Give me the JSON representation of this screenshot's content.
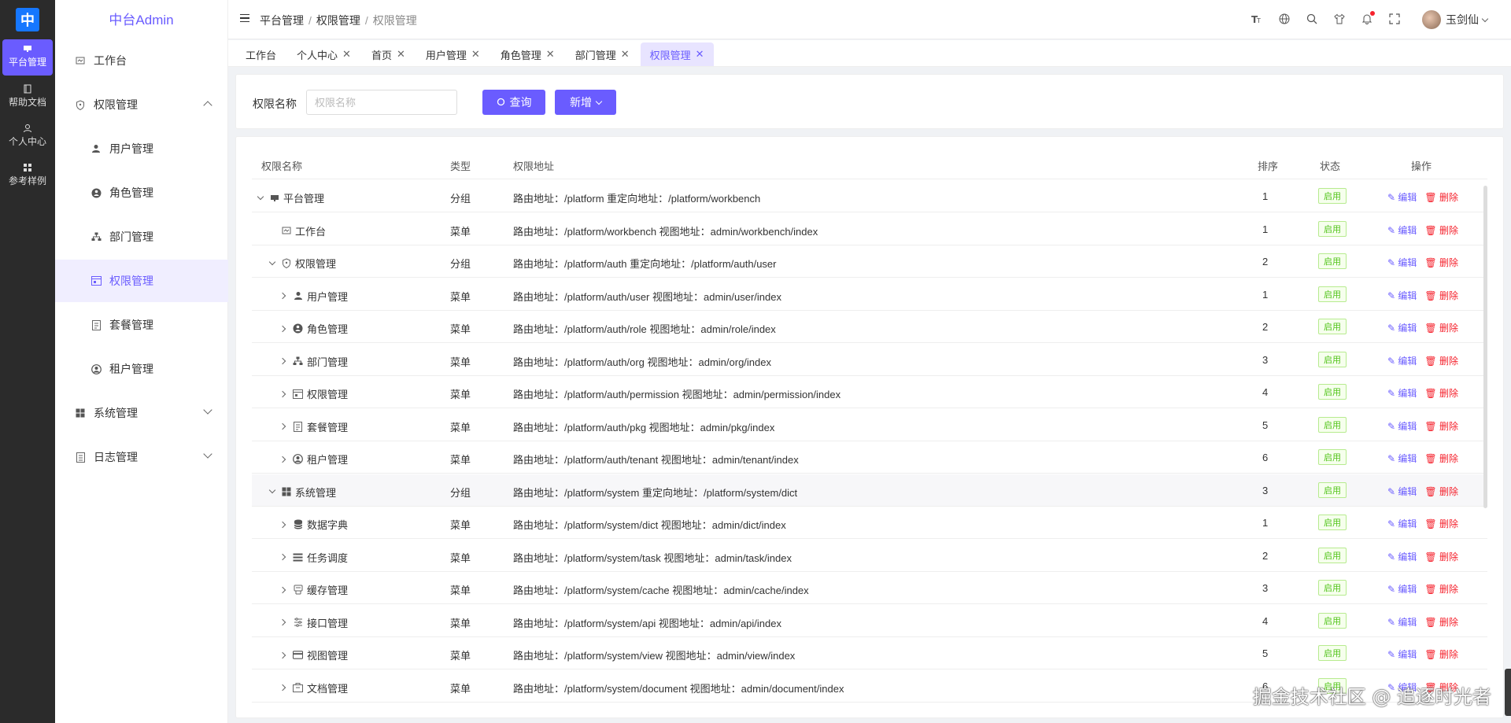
{
  "rail": {
    "logo": "中",
    "items": [
      {
        "label": "平台管理",
        "icon": "monitor-icon"
      },
      {
        "label": "帮助文档",
        "icon": "book-icon"
      },
      {
        "label": "个人中心",
        "icon": "user-icon"
      },
      {
        "label": "参考样例",
        "icon": "grid-icon"
      }
    ]
  },
  "sidebar": {
    "title": "中台Admin",
    "items": [
      {
        "label": "工作台",
        "icon": "dashboard-icon"
      },
      {
        "label": "权限管理",
        "icon": "shield-icon"
      },
      {
        "label": "用户管理",
        "icon": "user-icon"
      },
      {
        "label": "角色管理",
        "icon": "role-icon"
      },
      {
        "label": "部门管理",
        "icon": "org-icon"
      },
      {
        "label": "权限管理",
        "icon": "permission-icon"
      },
      {
        "label": "套餐管理",
        "icon": "package-icon"
      },
      {
        "label": "租户管理",
        "icon": "tenant-icon"
      },
      {
        "label": "系统管理",
        "icon": "windows-icon"
      },
      {
        "label": "日志管理",
        "icon": "log-icon"
      }
    ]
  },
  "header": {
    "breadcrumb": [
      "平台管理",
      "权限管理",
      "权限管理"
    ],
    "user_name": "玉剑仙"
  },
  "tabs": [
    {
      "label": "工作台",
      "closable": false
    },
    {
      "label": "个人中心",
      "closable": true
    },
    {
      "label": "首页",
      "closable": true
    },
    {
      "label": "用户管理",
      "closable": true
    },
    {
      "label": "角色管理",
      "closable": true
    },
    {
      "label": "部门管理",
      "closable": true
    },
    {
      "label": "权限管理",
      "closable": true
    }
  ],
  "search": {
    "label": "权限名称",
    "placeholder": "权限名称",
    "query_label": "查询",
    "add_label": "新增"
  },
  "table": {
    "columns": [
      "权限名称",
      "类型",
      "权限地址",
      "排序",
      "状态",
      "操作"
    ],
    "edit_label": "编辑",
    "delete_label": "删除",
    "rows": [
      {
        "name": "平台管理",
        "type": "分组",
        "addr": "路由地址：/platform 重定向地址：/platform/workbench",
        "sort": "1",
        "status": "启用"
      },
      {
        "name": "工作台",
        "type": "菜单",
        "addr": "路由地址：/platform/workbench 视图地址：admin/workbench/index",
        "sort": "1",
        "status": "启用"
      },
      {
        "name": "权限管理",
        "type": "分组",
        "addr": "路由地址：/platform/auth 重定向地址：/platform/auth/user",
        "sort": "2",
        "status": "启用"
      },
      {
        "name": "用户管理",
        "type": "菜单",
        "addr": "路由地址：/platform/auth/user 视图地址：admin/user/index",
        "sort": "1",
        "status": "启用"
      },
      {
        "name": "角色管理",
        "type": "菜单",
        "addr": "路由地址：/platform/auth/role 视图地址：admin/role/index",
        "sort": "2",
        "status": "启用"
      },
      {
        "name": "部门管理",
        "type": "菜单",
        "addr": "路由地址：/platform/auth/org 视图地址：admin/org/index",
        "sort": "3",
        "status": "启用"
      },
      {
        "name": "权限管理",
        "type": "菜单",
        "addr": "路由地址：/platform/auth/permission 视图地址：admin/permission/index",
        "sort": "4",
        "status": "启用"
      },
      {
        "name": "套餐管理",
        "type": "菜单",
        "addr": "路由地址：/platform/auth/pkg 视图地址：admin/pkg/index",
        "sort": "5",
        "status": "启用"
      },
      {
        "name": "租户管理",
        "type": "菜单",
        "addr": "路由地址：/platform/auth/tenant 视图地址：admin/tenant/index",
        "sort": "6",
        "status": "启用"
      },
      {
        "name": "系统管理",
        "type": "分组",
        "addr": "路由地址：/platform/system 重定向地址：/platform/system/dict",
        "sort": "3",
        "status": "启用"
      },
      {
        "name": "数据字典",
        "type": "菜单",
        "addr": "路由地址：/platform/system/dict 视图地址：admin/dict/index",
        "sort": "1",
        "status": "启用"
      },
      {
        "name": "任务调度",
        "type": "菜单",
        "addr": "路由地址：/platform/system/task 视图地址：admin/task/index",
        "sort": "2",
        "status": "启用"
      },
      {
        "name": "缓存管理",
        "type": "菜单",
        "addr": "路由地址：/platform/system/cache 视图地址：admin/cache/index",
        "sort": "3",
        "status": "启用"
      },
      {
        "name": "接口管理",
        "type": "菜单",
        "addr": "路由地址：/platform/system/api 视图地址：admin/api/index",
        "sort": "4",
        "status": "启用"
      },
      {
        "name": "视图管理",
        "type": "菜单",
        "addr": "路由地址：/platform/system/view 视图地址：admin/view/index",
        "sort": "5",
        "status": "启用"
      },
      {
        "name": "文档管理",
        "type": "菜单",
        "addr": "路由地址：/platform/system/document 视图地址：admin/document/index",
        "sort": "6",
        "status": "启用"
      }
    ]
  },
  "watermark": "掘金技术社区 @ 追逐时光者",
  "colors": {
    "accent": "#6a5cff",
    "success": "#52c41a",
    "danger": "#f5222d",
    "rail": "#2b2b2b"
  }
}
